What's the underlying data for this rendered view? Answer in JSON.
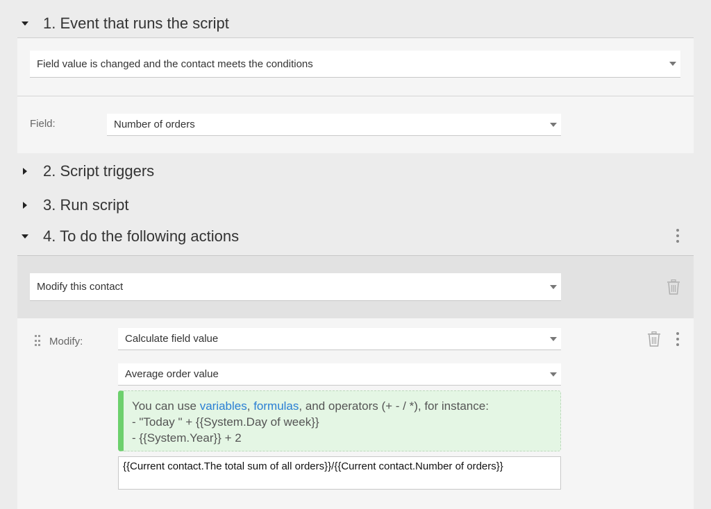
{
  "sections": {
    "s1": {
      "title": "1. Event that runs the script"
    },
    "s2": {
      "title": "2. Script triggers"
    },
    "s3": {
      "title": "3. Run script"
    },
    "s4": {
      "title": "4. To do the following actions"
    }
  },
  "event": {
    "selected": "Field value is changed and the contact meets the conditions",
    "field_label": "Field:",
    "field_value": "Number of orders"
  },
  "action": {
    "selected": "Modify this contact",
    "modify_label": "Modify:",
    "modify_mode": "Calculate field value",
    "target_field": "Average order value",
    "hint": {
      "prefix": "You can use ",
      "link_variables": "variables",
      "sep": ", ",
      "link_formulas": "formulas",
      "suffix": ", and operators (+ - / *), for instance:",
      "example1": "- \"Today \" + {{System.Day of week}}",
      "example2": "- {{System.Year}} + 2"
    },
    "formula": "{{Current contact.The total sum of all orders}}/{{Current contact.Number of orders}}"
  },
  "colors": {
    "accent_green": "#6cd06c",
    "link_blue": "#2a7fd4",
    "panel_white": "#f5f5f5",
    "panel_gray": "#e2e2e2"
  }
}
